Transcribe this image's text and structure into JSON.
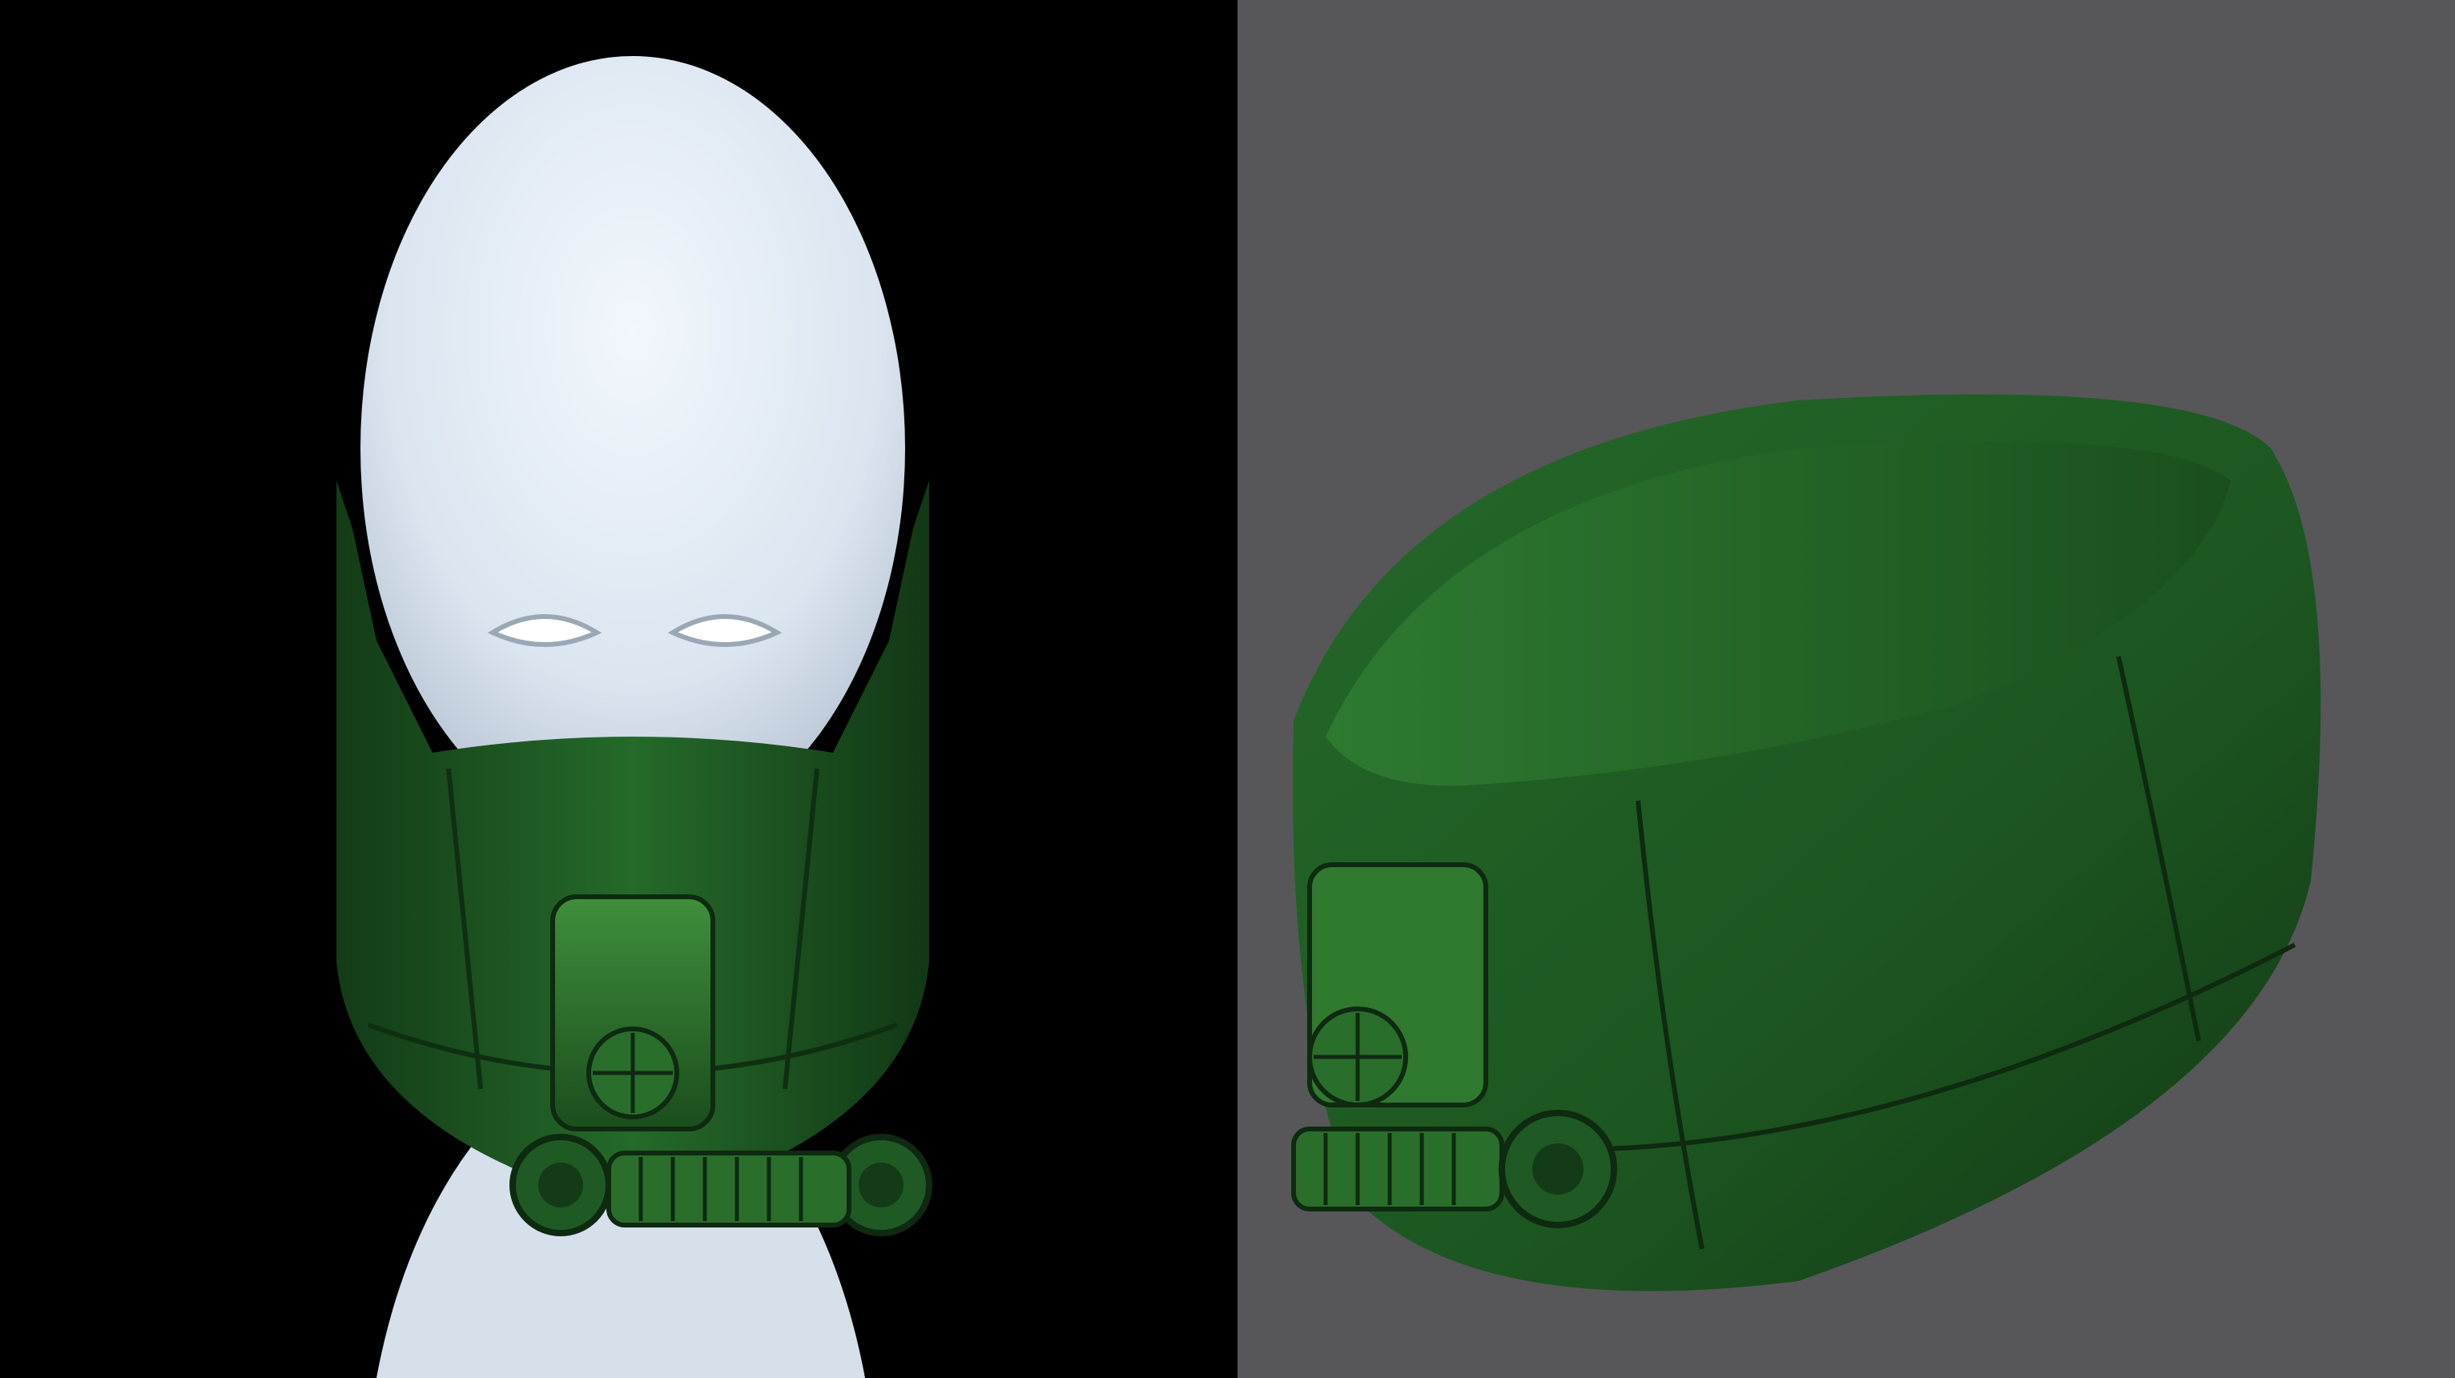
{
  "colors": {
    "left_background": "#000000",
    "right_background": "#575759",
    "mannequin": "#e4edf7",
    "mask_green": "#1f5a24",
    "mask_green_dark": "#143f18",
    "filter_green": "#2f7a2f"
  },
  "views": [
    {
      "subject": "mask-on-mannequin",
      "background": "black"
    },
    {
      "subject": "mask-three-quarter",
      "background": "grey"
    }
  ]
}
